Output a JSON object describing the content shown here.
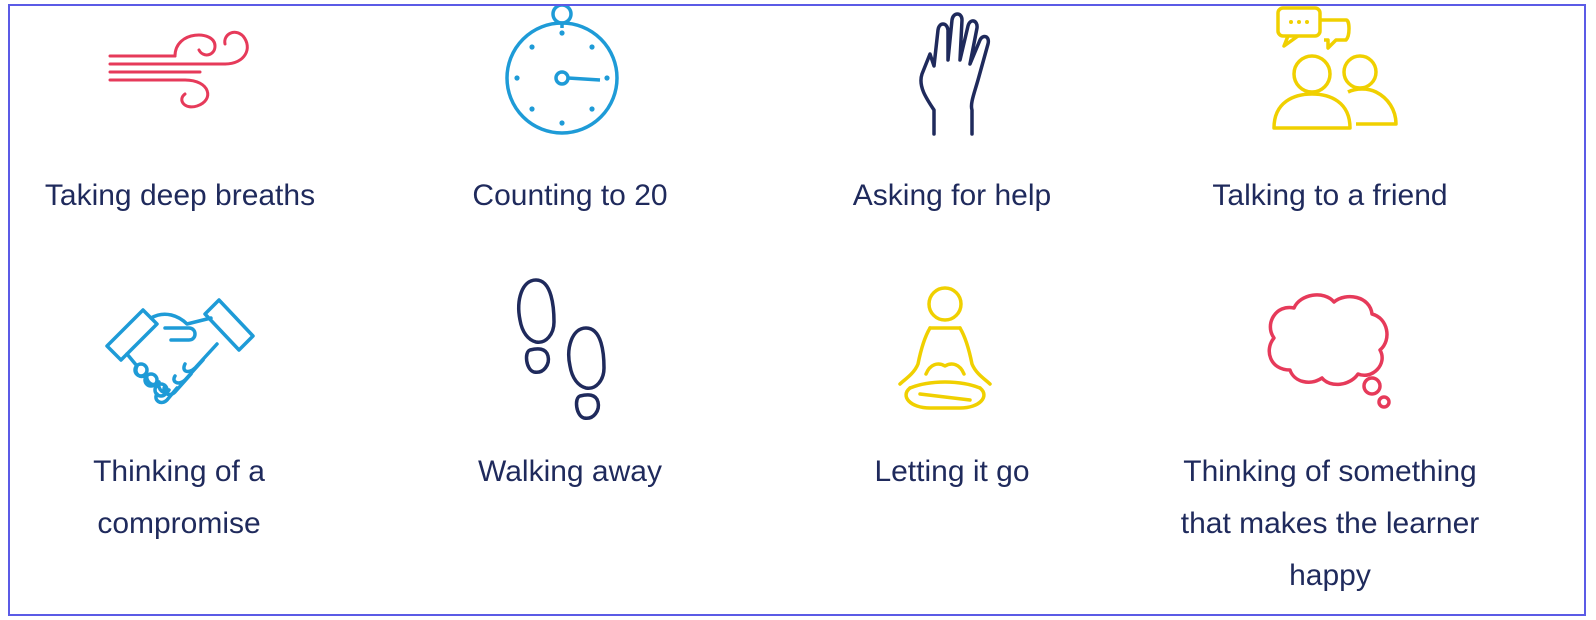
{
  "colors": {
    "red": "#e63a5a",
    "blue": "#1e9bd7",
    "navy": "#1f2a5c",
    "yellow": "#f0d000",
    "border": "#5b5be6"
  },
  "items": [
    {
      "icon": "wind-icon",
      "label": "Taking deep breaths"
    },
    {
      "icon": "stopwatch-icon",
      "label": "Counting to 20"
    },
    {
      "icon": "raised-hand-icon",
      "label": "Asking for help"
    },
    {
      "icon": "people-talking-icon",
      "label": "Talking to a friend"
    },
    {
      "icon": "handshake-icon",
      "label": "Thinking of a compromise"
    },
    {
      "icon": "footprints-icon",
      "label": "Walking away"
    },
    {
      "icon": "meditation-icon",
      "label": "Letting it go"
    },
    {
      "icon": "thought-bubble-icon",
      "label": "Thinking of something that makes the learner happy"
    }
  ]
}
